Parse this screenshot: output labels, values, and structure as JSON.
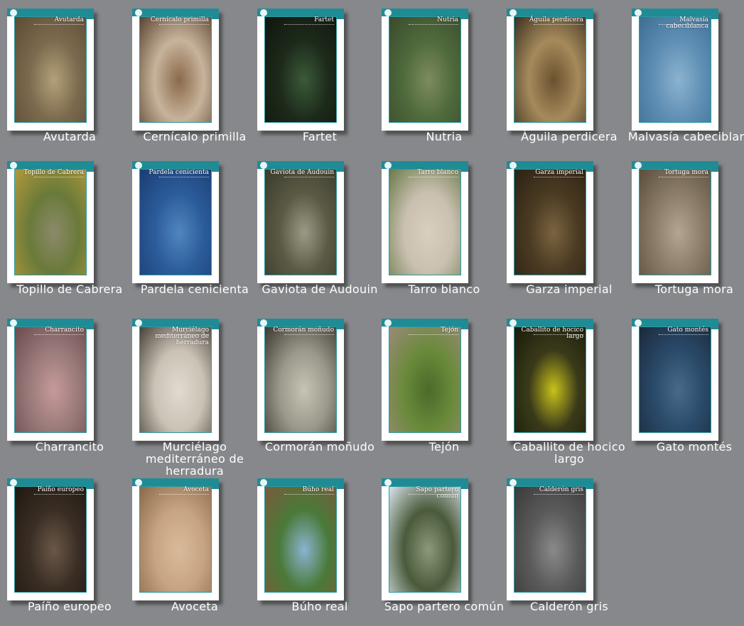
{
  "species": [
    {
      "caption": "Avutarda",
      "cover_title": "Avutarda",
      "photo": [
        "#7b6a4e",
        "#b4a079",
        "#5c4b33"
      ]
    },
    {
      "caption": "Cernícalo primilla",
      "cover_title": "Cernícalo primilla",
      "photo": [
        "#c7b39b",
        "#8a6a4b",
        "#5b4330"
      ]
    },
    {
      "caption": "Fartet",
      "cover_title": "Fartet",
      "photo": [
        "#1d2a1b",
        "#3b5a38",
        "#0f150d"
      ]
    },
    {
      "caption": "Nutria",
      "cover_title": "Nutria",
      "photo": [
        "#4f6a3c",
        "#7d8c5e",
        "#3a4a2c"
      ]
    },
    {
      "caption": "Águila perdicera",
      "cover_title": "Águila perdicera",
      "photo": [
        "#a58a5b",
        "#6b5230",
        "#3b3020"
      ]
    },
    {
      "caption": "Malvasía cabeciblanca",
      "cover_title": "Malvasía cabeciblanca",
      "photo": [
        "#5f8fb4",
        "#8cb3cf",
        "#3d6d92"
      ]
    },
    {
      "caption": "Topillo de Cabrera",
      "cover_title": "Topillo de Cabrera",
      "photo": [
        "#6a7a3a",
        "#8c8a6a",
        "#b29a3a"
      ]
    },
    {
      "caption": "Pardela cenicienta",
      "cover_title": "Pardela cenicienta",
      "photo": [
        "#2b5c9a",
        "#4f86c0",
        "#1b3d72"
      ]
    },
    {
      "caption": "Gaviota de Audouin",
      "cover_title": "Gaviota de Audouin",
      "photo": [
        "#5a5a44",
        "#9a9a86",
        "#3a3a2c"
      ]
    },
    {
      "caption": "Tarro blanco",
      "cover_title": "Tarro blanco",
      "photo": [
        "#c9c0b0",
        "#d9cfbf",
        "#6a7a4a"
      ]
    },
    {
      "caption": "Garza imperial",
      "cover_title": "Garza imperial",
      "photo": [
        "#4a3a22",
        "#7a6440",
        "#2a2214"
      ]
    },
    {
      "caption": "Tortuga mora",
      "cover_title": "Tortuga mora",
      "photo": [
        "#8a7c68",
        "#b3a591",
        "#5a4e3c"
      ]
    },
    {
      "caption": "Charrancito",
      "cover_title": "Charrancito",
      "photo": [
        "#9a7a7a",
        "#c79a9a",
        "#6a4a4a"
      ]
    },
    {
      "caption": "Murciélago mediterráneo de herradura",
      "cover_title": "Murciélago mediterráneo de herradura",
      "photo": [
        "#c9c2b5",
        "#e0dad0",
        "#4a4038"
      ]
    },
    {
      "caption": "Cormorán moñudo",
      "cover_title": "Cormorán moñudo",
      "photo": [
        "#9a988a",
        "#c7c4b5",
        "#3a3830"
      ]
    },
    {
      "caption": "Tejón",
      "cover_title": "Tejón",
      "photo": [
        "#6a8a3a",
        "#4a6a2a",
        "#9a8a7a"
      ]
    },
    {
      "caption": "Caballito de hocico largo",
      "cover_title": "Caballito de hocico largo",
      "photo": [
        "#3a3a1a",
        "#c9c21a",
        "#1a1a0a"
      ]
    },
    {
      "caption": "Gato montés",
      "cover_title": "Gato montés",
      "photo": [
        "#2a4a6a",
        "#4a6a8a",
        "#1a2a3a"
      ]
    },
    {
      "caption": "Paíño europeo",
      "cover_title": "Paíño europeo",
      "photo": [
        "#3a2e24",
        "#6a5848",
        "#1e1812"
      ]
    },
    {
      "caption": "Avoceta",
      "cover_title": "Avoceta",
      "photo": [
        "#c7a482",
        "#d8bb9a",
        "#8a6a4a"
      ]
    },
    {
      "caption": "Búho real",
      "cover_title": "Búho real",
      "photo": [
        "#4a7a3a",
        "#8ab3d0",
        "#7a5a3a"
      ]
    },
    {
      "caption": "Sapo partero común",
      "cover_title": "Sapo partero común",
      "photo": [
        "#4a5a3a",
        "#8a9a7a",
        "#d9e4ea"
      ]
    },
    {
      "caption": "Calderón gris",
      "cover_title": "Calderón gris",
      "photo": [
        "#5a5a5a",
        "#8a8a8a",
        "#3a3a3a"
      ]
    }
  ],
  "colors": {
    "background": "#86888b",
    "accent": "#1f8c95",
    "caption_text": "#ffffff"
  }
}
